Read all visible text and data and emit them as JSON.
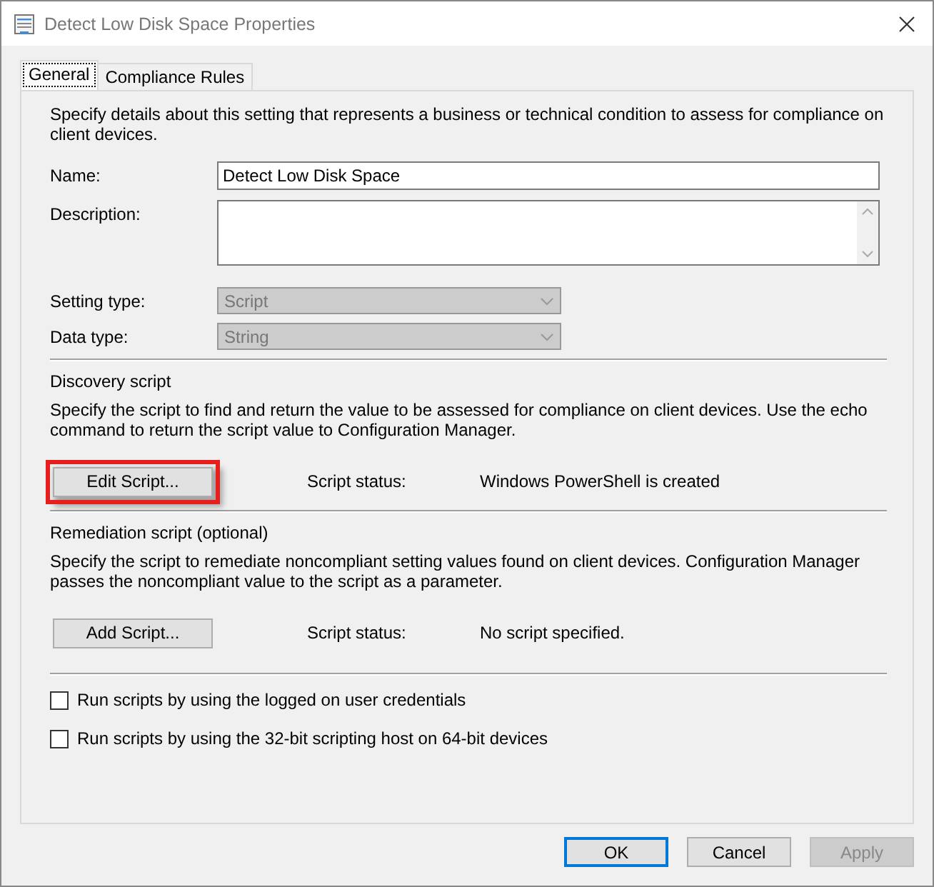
{
  "window": {
    "title": "Detect Low Disk Space Properties"
  },
  "tabs": [
    {
      "label": "General",
      "selected": true
    },
    {
      "label": "Compliance Rules",
      "selected": false
    }
  ],
  "intro": "Specify details about this setting that represents a business or technical condition to assess for compliance on client devices.",
  "fields": [
    {
      "kind": "text",
      "label": "Name:",
      "value": "Detect Low Disk Space"
    },
    {
      "kind": "textarea",
      "label": "Description:"
    },
    {
      "kind": "select",
      "label": "Setting type:",
      "value": "Script",
      "disabled": true
    },
    {
      "kind": "select",
      "label": "Data type:",
      "value": "String",
      "disabled": true
    }
  ],
  "sections": [
    {
      "title": "Discovery script",
      "description": "Specify the script to find and return the value to be assessed for compliance on client devices. Use the echo command to return the script value to Configuration Manager.",
      "button": "Edit Script...",
      "highlighted": true,
      "status_label": "Script status:",
      "status": "Windows PowerShell is created"
    },
    {
      "title": "Remediation script (optional)",
      "description": "Specify the script to remediate noncompliant setting values found on client devices. Configuration Manager passes the noncompliant value to the script as a parameter.",
      "button": "Add Script...",
      "highlighted": false,
      "status_label": "Script status:",
      "status": "No script specified."
    }
  ],
  "options": [
    {
      "label": "Run scripts by using the logged on user credentials",
      "checked": false
    },
    {
      "label": "Run scripts by using the 32-bit scripting host on 64-bit devices",
      "checked": false
    }
  ],
  "buttons": [
    {
      "label": "OK",
      "default": true,
      "disabled": false
    },
    {
      "label": "Cancel",
      "default": false,
      "disabled": false
    },
    {
      "label": "Apply",
      "default": false,
      "disabled": true
    }
  ]
}
